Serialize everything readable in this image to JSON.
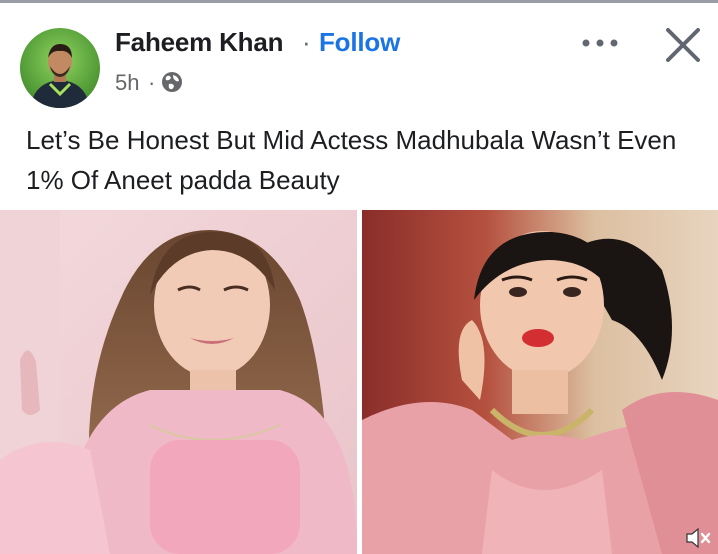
{
  "post": {
    "author_name": "Faheem Khan",
    "separator": "·",
    "follow_label": "Follow",
    "time": "5h",
    "time_separator": "·",
    "caption": "Let’s Be Honest But Mid Actess Madhubala Wasn’t Even 1% Of Aneet padda Beauty"
  },
  "icons": {
    "audience": "globe-icon",
    "menu": "more-options-icon",
    "close": "close-icon",
    "mute": "mute-icon"
  },
  "colors": {
    "follow_blue": "#1b74e4",
    "text_primary": "#1c1e21",
    "text_secondary": "#65676b",
    "avatar_bg": "#5aa83c"
  }
}
